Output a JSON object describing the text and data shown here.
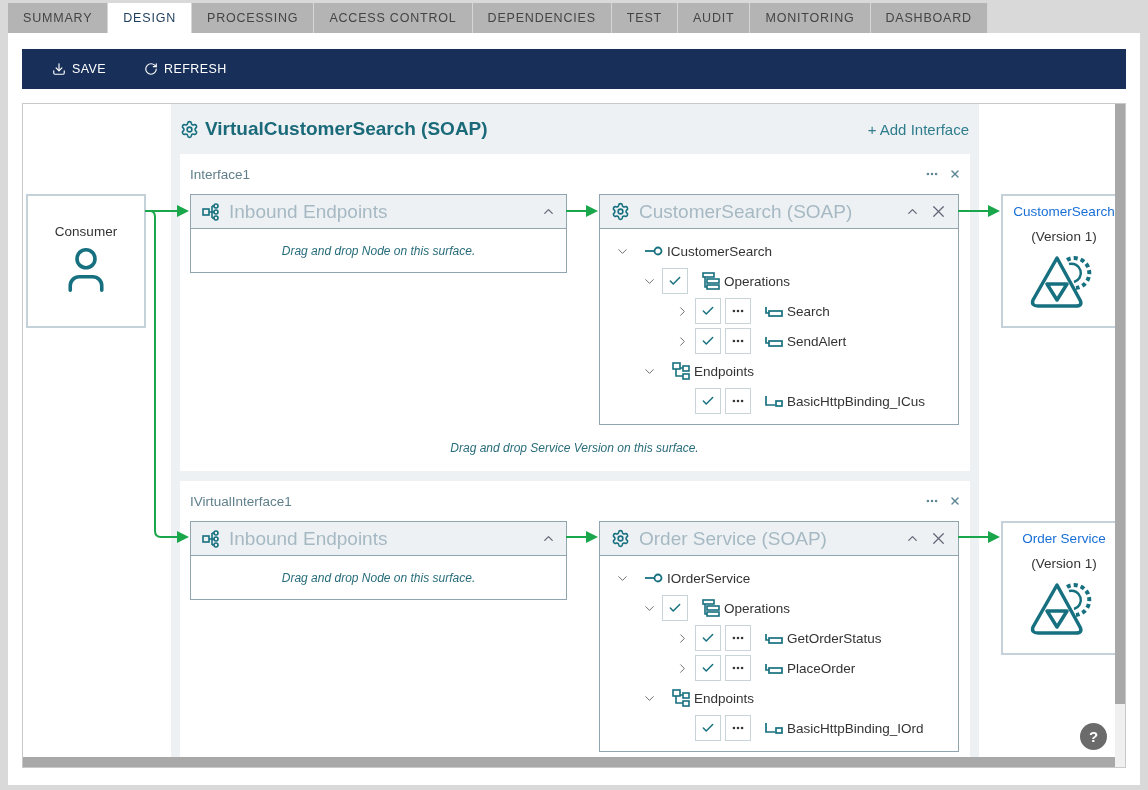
{
  "tabs": [
    {
      "label": "SUMMARY",
      "selected": false
    },
    {
      "label": "DESIGN",
      "selected": true
    },
    {
      "label": "PROCESSING",
      "selected": false
    },
    {
      "label": "ACCESS CONTROL",
      "selected": false
    },
    {
      "label": "DEPENDENCIES",
      "selected": false
    },
    {
      "label": "TEST",
      "selected": false
    },
    {
      "label": "AUDIT",
      "selected": false
    },
    {
      "label": "MONITORING",
      "selected": false
    },
    {
      "label": "DASHBOARD",
      "selected": false
    }
  ],
  "toolbar": [
    {
      "kind": "save",
      "label": "SAVE"
    },
    {
      "kind": "refresh",
      "label": "REFRESH"
    }
  ],
  "consumer": {
    "label": "Consumer"
  },
  "virtual_service": {
    "title": "VirtualCustomerSearch (SOAP)",
    "add_interface": "+ Add Interface",
    "interfaces": [
      {
        "name": "Interface1",
        "inbound": {
          "title": "Inbound Endpoints",
          "hint": "Drag and drop Node on this surface."
        },
        "service": {
          "title": "CustomerSearch (SOAP)",
          "tree": [
            {
              "kind": "interface",
              "label": "ICustomerSearch",
              "expanded": true,
              "children": [
                {
                  "kind": "operations",
                  "label": "Operations",
                  "expanded": true,
                  "checked": true,
                  "children": [
                    {
                      "kind": "operation",
                      "label": "Search",
                      "expanded": false,
                      "checked": true
                    },
                    {
                      "kind": "operation",
                      "label": "SendAlert",
                      "expanded": false,
                      "checked": true
                    }
                  ]
                },
                {
                  "kind": "endpoints",
                  "label": "Endpoints",
                  "expanded": true,
                  "children": [
                    {
                      "kind": "endpoint",
                      "label": "BasicHttpBinding_ICus",
                      "checked": true
                    }
                  ]
                }
              ]
            }
          ]
        },
        "hint": "Drag and drop Service Version on this surface.",
        "target": {
          "name": "CustomerSearch",
          "version": "(Version 1)"
        }
      },
      {
        "name": "IVirtualInterface1",
        "inbound": {
          "title": "Inbound Endpoints",
          "hint": "Drag and drop Node on this surface."
        },
        "service": {
          "title": "Order Service (SOAP)",
          "tree": [
            {
              "kind": "interface",
              "label": "IOrderService",
              "expanded": true,
              "children": [
                {
                  "kind": "operations",
                  "label": "Operations",
                  "expanded": true,
                  "checked": true,
                  "children": [
                    {
                      "kind": "operation",
                      "label": "GetOrderStatus",
                      "expanded": false,
                      "checked": true
                    },
                    {
                      "kind": "operation",
                      "label": "PlaceOrder",
                      "expanded": false,
                      "checked": true
                    }
                  ]
                },
                {
                  "kind": "endpoints",
                  "label": "Endpoints",
                  "expanded": true,
                  "children": [
                    {
                      "kind": "endpoint",
                      "label": "BasicHttpBinding_IOrd",
                      "checked": true
                    }
                  ]
                }
              ]
            }
          ]
        },
        "target": {
          "name": "Order Service",
          "version": "(Version 1)"
        }
      }
    ]
  },
  "help": {
    "label": "?"
  }
}
